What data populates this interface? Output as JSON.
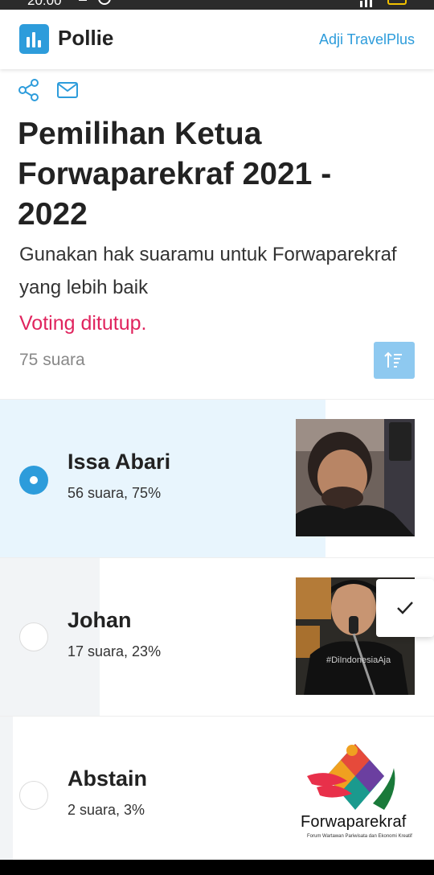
{
  "status_bar": {
    "time": "20:00"
  },
  "header": {
    "brand": "Pollie",
    "user_link": "Adji TravelPlus"
  },
  "poll": {
    "title": "Pemilihan Ketua Forwaparekraf 2021 - 2022",
    "description": "Gunakan hak suaramu untuk Forwaparekraf yang lebih baik",
    "status": "Voting ditutup.",
    "total_votes": "75 suara"
  },
  "options": [
    {
      "name": "Issa Abari",
      "stats": "56 suara, 75%",
      "percent": 75,
      "selected": true
    },
    {
      "name": "Johan",
      "stats": "17 suara, 23%",
      "percent": 23,
      "selected": false
    },
    {
      "name": "Abstain",
      "stats": "2 suara, 3%",
      "percent": 3,
      "selected": false
    }
  ],
  "logo_text": {
    "wordmark": "Forwaparekraf",
    "tagline": "Forum Wartawan Pariwisata dan Ekonomi Kreatif",
    "photo_caption": "#DiIndonesiaAja"
  },
  "colors": {
    "accent": "#2d9cdb",
    "closed": "#e0245e",
    "selected_fill": "#e8f5fd",
    "unselected_fill": "#f2f4f6"
  },
  "icons": [
    "share-icon",
    "mail-icon",
    "sort-icon",
    "check-icon"
  ]
}
